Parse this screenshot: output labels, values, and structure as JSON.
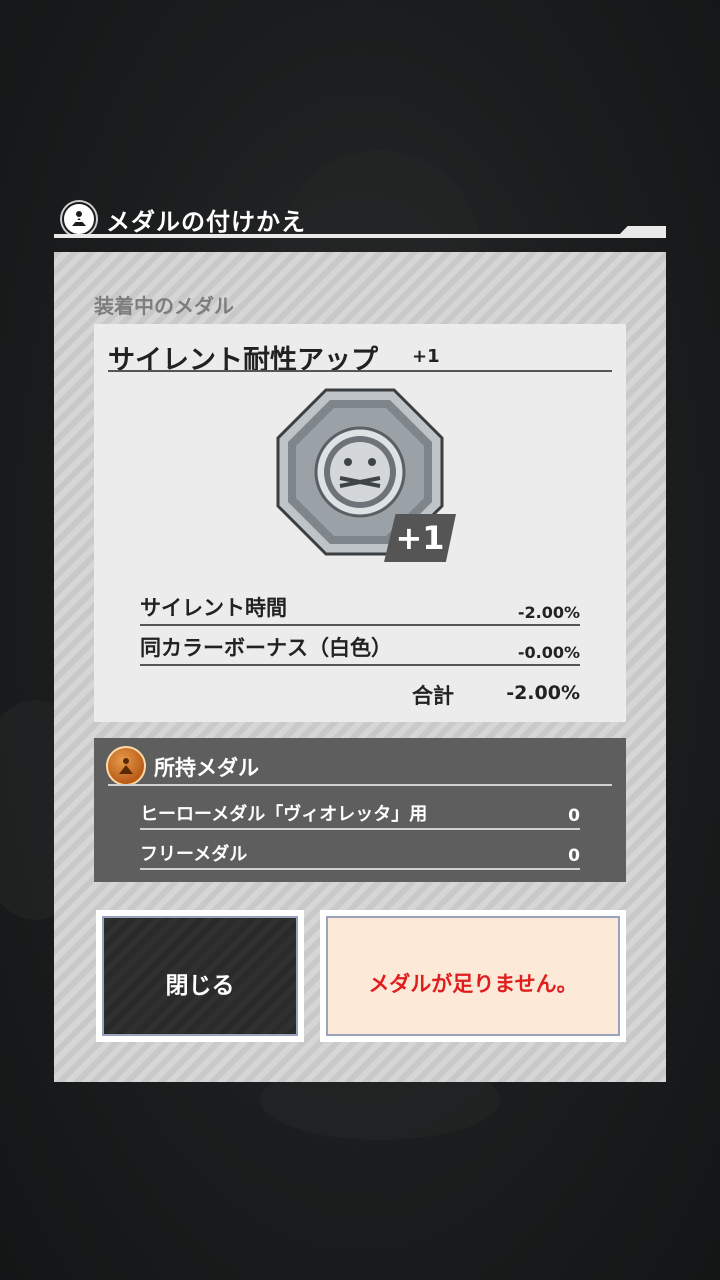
{
  "dialog": {
    "title": "メダルの付けかえ"
  },
  "equipped": {
    "section_label": "装着中のメダル",
    "medal_name": "サイレント耐性アップ",
    "medal_level": "+1",
    "badge_level": "+1",
    "stats": [
      {
        "label": "サイレント時間",
        "value": "-2.00%"
      },
      {
        "label": "同カラーボーナス（白色）",
        "value": "-0.00%"
      }
    ],
    "total_label": "合計",
    "total_value": "-2.00%"
  },
  "owned": {
    "title": "所持メダル",
    "items": [
      {
        "label": "ヒーローメダル「ヴィオレッタ」用",
        "count": "0"
      },
      {
        "label": "フリーメダル",
        "count": "0"
      }
    ]
  },
  "buttons": {
    "close_label": "閉じる",
    "confirm_label": "メダルが足りません。"
  },
  "colors": {
    "warning_text": "#e01e1e",
    "owned_bg": "#5e5e5e",
    "confirm_bg": "#fde9d7"
  },
  "icons": {
    "header": "medal-emblem-icon",
    "medal": "silence-medal-icon",
    "owned": "bronze-medal-icon"
  }
}
